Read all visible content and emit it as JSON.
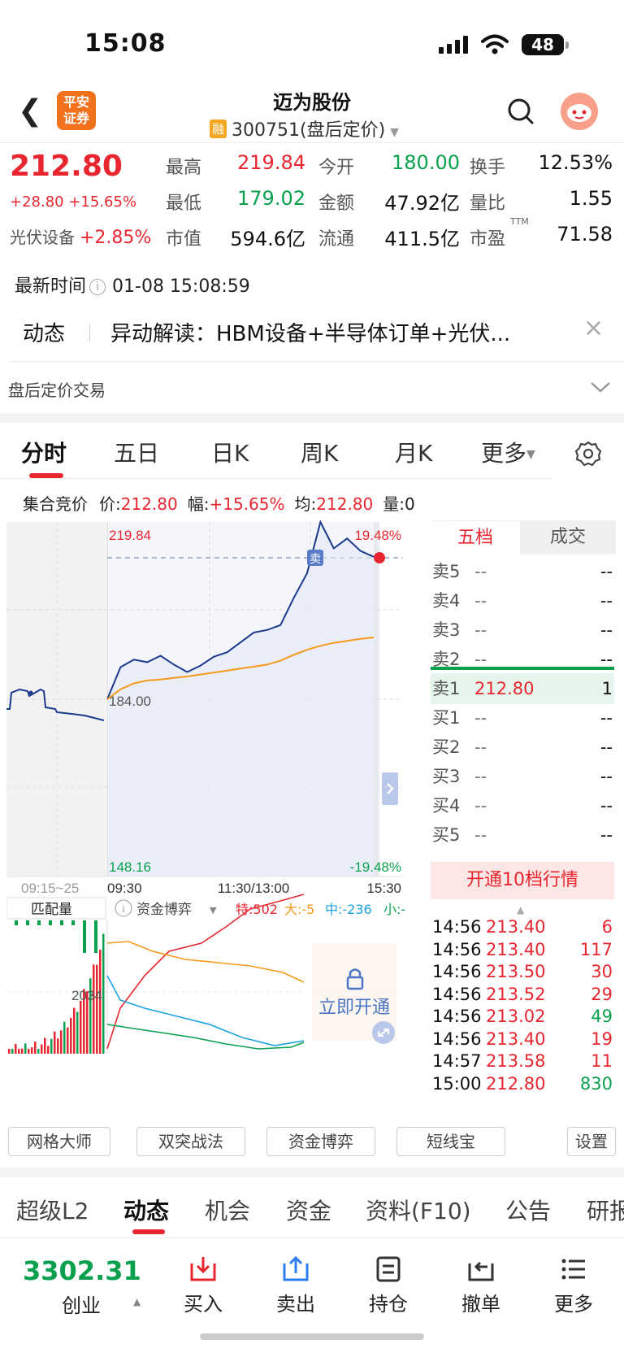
{
  "status_bar": {
    "time": "15:08",
    "battery": "48"
  },
  "header": {
    "broker_logo_line1": "平安",
    "broker_logo_line2": "证券",
    "stock_name": "迈为股份",
    "badge": "融",
    "code_line": "300751(盘后定价)"
  },
  "quote": {
    "price": "212.80",
    "change": "+28.80 +15.65%",
    "sector_name": "光伏设备",
    "sector_change": "+2.85%",
    "stats": [
      {
        "label": "最高",
        "value": "219.84",
        "color": "red"
      },
      {
        "label": "今开",
        "value": "180.00",
        "color": "green"
      },
      {
        "label": "换手",
        "value": "12.53%",
        "color": "black"
      },
      {
        "label": "最低",
        "value": "179.02",
        "color": "green"
      },
      {
        "label": "金额",
        "value": "47.92亿",
        "color": "black"
      },
      {
        "label": "量比",
        "value": "1.55",
        "color": "black"
      },
      {
        "label": "市值",
        "value": "594.6亿",
        "color": "black"
      },
      {
        "label": "流通",
        "value": "411.5亿",
        "color": "black"
      },
      {
        "label": "市盈",
        "value": "71.58",
        "color": "black",
        "superscript": "TTM"
      }
    ],
    "latest_time_label": "最新时间",
    "latest_time": "01-08 15:08:59"
  },
  "news": {
    "tag": "动态",
    "text": "异动解读：HBM设备+半导体订单+光伏..."
  },
  "after_hours": {
    "label": "盘后定价交易"
  },
  "chart_tabs": [
    "分时",
    "五日",
    "日K",
    "周K",
    "月K",
    "更多"
  ],
  "auction_row": {
    "label": "集合竞价",
    "price_label": "价:",
    "price": "212.80",
    "amp_label": "幅:",
    "amp": "+15.65%",
    "avg_label": "均:",
    "avg": "212.80",
    "vol_label": "量:",
    "vol": "0"
  },
  "chart_labels": {
    "top_price": "219.84",
    "top_pct": "19.48%",
    "mid_price": "184.00",
    "bottom_price": "148.16",
    "bottom_pct": "-19.48%",
    "sell_marker": "卖",
    "time_auction": "09:15~25",
    "time_open": "09:30",
    "time_mid": "11:30/13:00",
    "time_close": "15:30",
    "sub_left_label": "匹配量",
    "sub_indicator": "资金博弈",
    "sub_te": "特:502",
    "sub_da": "大:-5",
    "sub_zhong": "中:-236",
    "sub_xiao": "小:-",
    "sub_value": "2034",
    "unlock_label": "立即开通"
  },
  "chart_data": {
    "type": "line",
    "title": "",
    "ylim": [
      148.16,
      219.84
    ],
    "x_ticks": [
      "09:30",
      "11:30/13:00",
      "15:30"
    ],
    "series": [
      {
        "name": "价",
        "values": [
          184.0,
          190.5,
          192.0,
          191.5,
          192.8,
          191.0,
          189.5,
          190.8,
          192.6,
          193.5,
          195.5,
          197.5,
          198.0,
          199.0,
          204.5,
          209.5,
          219.84,
          214.5,
          216.5,
          214.0,
          212.8
        ]
      },
      {
        "name": "均",
        "values": [
          184.0,
          186.0,
          187.2,
          187.8,
          188.0,
          188.3,
          188.6,
          189.0,
          189.4,
          189.8,
          190.2,
          190.6,
          191.0,
          191.8,
          193.0,
          194.0,
          194.8,
          195.4,
          195.8,
          196.2,
          196.5
        ]
      }
    ]
  },
  "orderbook": {
    "tabs": [
      "五档",
      "成交"
    ],
    "rows": [
      {
        "label": "卖5",
        "price": "--",
        "vol": "--"
      },
      {
        "label": "卖4",
        "price": "--",
        "vol": "--"
      },
      {
        "label": "卖3",
        "price": "--",
        "vol": "--"
      },
      {
        "label": "卖2",
        "price": "--",
        "vol": "--"
      },
      {
        "label": "卖1",
        "price": "212.80",
        "vol": "1"
      },
      {
        "label": "买1",
        "price": "--",
        "vol": "--"
      },
      {
        "label": "买2",
        "price": "--",
        "vol": "--"
      },
      {
        "label": "买3",
        "price": "--",
        "vol": "--"
      },
      {
        "label": "买4",
        "price": "--",
        "vol": "--"
      },
      {
        "label": "买5",
        "price": "--",
        "vol": "--"
      }
    ],
    "upgrade_label": "开通10档行情",
    "trades": [
      {
        "time": "14:56",
        "price": "213.40",
        "vol": "6",
        "side": "red"
      },
      {
        "time": "14:56",
        "price": "213.40",
        "vol": "117",
        "side": "red"
      },
      {
        "time": "14:56",
        "price": "213.50",
        "vol": "30",
        "side": "red"
      },
      {
        "time": "14:56",
        "price": "213.52",
        "vol": "29",
        "side": "red"
      },
      {
        "time": "14:56",
        "price": "213.02",
        "vol": "49",
        "side": "green"
      },
      {
        "time": "14:56",
        "price": "213.40",
        "vol": "19",
        "side": "red"
      },
      {
        "time": "14:57",
        "price": "213.58",
        "vol": "11",
        "side": "red"
      },
      {
        "time": "15:00",
        "price": "212.80",
        "vol": "830",
        "side": "green"
      }
    ]
  },
  "tools": [
    "网格大师",
    "双突战法",
    "资金博弈",
    "短线宝",
    "设置"
  ],
  "bottom_tabs": [
    "超级L2",
    "动态",
    "机会",
    "资金",
    "资料(F10)",
    "公告",
    "研报"
  ],
  "index_bar": {
    "value": "3302.31",
    "name": "创业"
  },
  "actions": [
    "买入",
    "卖出",
    "持仓",
    "撤单",
    "更多"
  ],
  "colors": {
    "up": "#e8262f",
    "down": "#0aa04e",
    "price_line": "#1c3a8c",
    "avg_line": "#f59a1b",
    "accent_bg": "#fde7e6"
  }
}
